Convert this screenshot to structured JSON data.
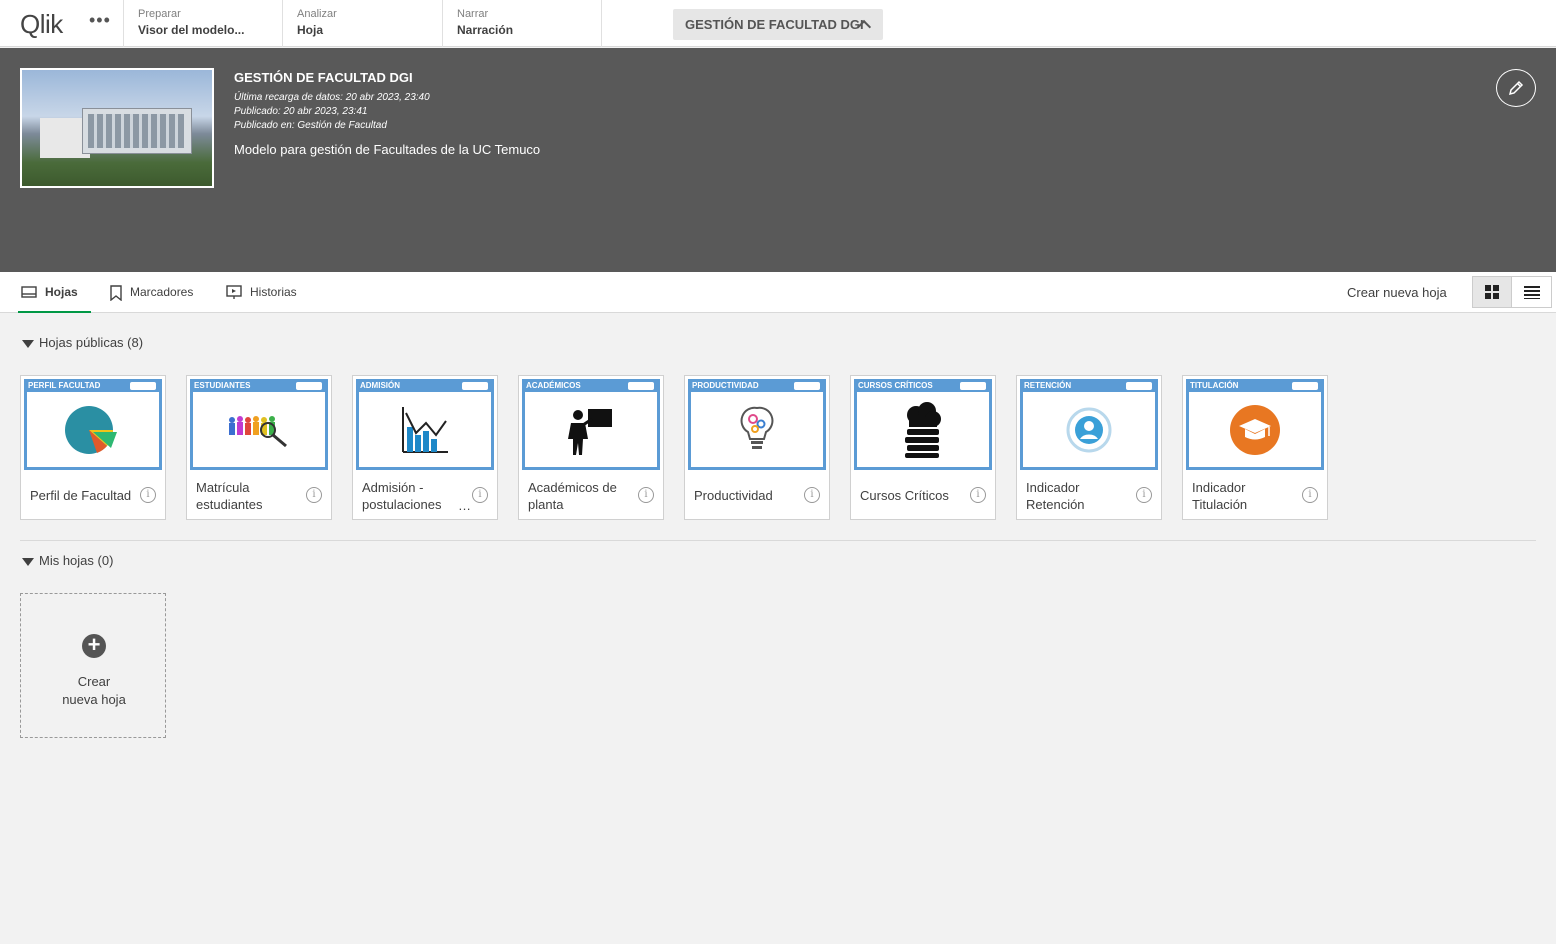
{
  "topbar": {
    "logo": "Qlik",
    "menu_dots": "•••",
    "sections": [
      {
        "label": "Preparar",
        "value": "Visor del modelo..."
      },
      {
        "label": "Analizar",
        "value": "Hoja"
      },
      {
        "label": "Narrar",
        "value": "Narración"
      }
    ],
    "app_title": "GESTIÓN DE FACULTAD DGI"
  },
  "header": {
    "title": "GESTIÓN DE FACULTAD DGI",
    "last_reload": "Última recarga de datos: 20 abr 2023, 23:40",
    "published": "Publicado: 20 abr 2023, 23:41",
    "published_in": "Publicado en: Gestión de Facultad",
    "description": "Modelo para gestión de Facultades de la UC Temuco"
  },
  "tabs": [
    {
      "label": "Hojas",
      "icon": "sheet-icon"
    },
    {
      "label": "Marcadores",
      "icon": "bookmark-icon"
    },
    {
      "label": "Historias",
      "icon": "story-icon"
    }
  ],
  "create_new_sheet": "Crear nueva hoja",
  "public_sheets": {
    "heading": "Hojas públicas (8)",
    "cards": [
      {
        "tag": "PERFIL FACULTAD",
        "name": "Perfil de Facultad",
        "icon": "pie-chart-icon"
      },
      {
        "tag": "ESTUDIANTES",
        "name": "Matrícula estudiantes",
        "icon": "people-search-icon"
      },
      {
        "tag": "ADMISIÓN",
        "name": "Admisión - postulaciones",
        "icon": "bar-chart-icon"
      },
      {
        "tag": "ACADÉMICOS",
        "name": "Académicos de planta",
        "icon": "teacher-icon"
      },
      {
        "tag": "PRODUCTIVIDAD",
        "name": "Productividad",
        "icon": "lightbulb-icon"
      },
      {
        "tag": "CURSOS CRÍTICOS",
        "name": "Cursos Críticos",
        "icon": "books-cloud-icon"
      },
      {
        "tag": "RETENCIÓN",
        "name": "Indicador Retención",
        "icon": "user-retention-icon"
      },
      {
        "tag": "TITULACIÓN",
        "name": "Indicador Titulación",
        "icon": "graduation-cap-icon"
      }
    ]
  },
  "my_sheets": {
    "heading": "Mis hojas (0)",
    "new_card_label": "Crear nueva hoja"
  },
  "ellipsis": "…",
  "info_glyph": "i",
  "accent": "#009845",
  "card_header_color": "#5b9bd5"
}
